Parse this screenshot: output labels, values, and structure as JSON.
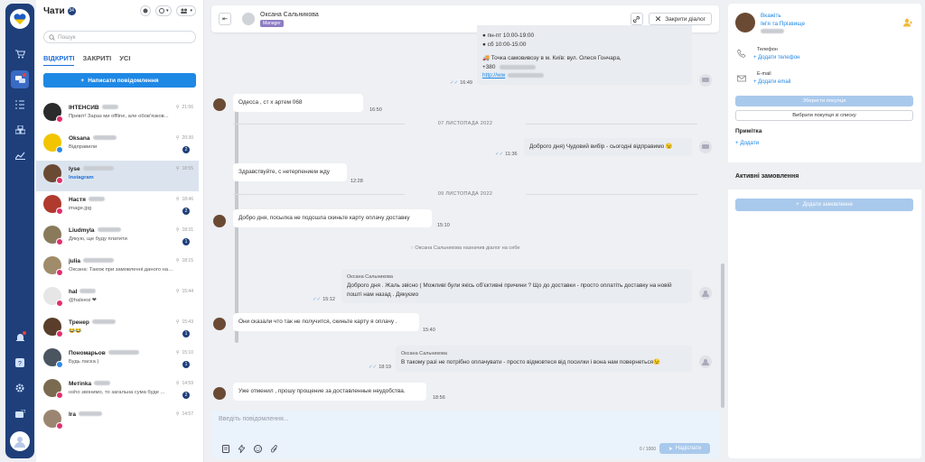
{
  "app": {
    "title": "Чати",
    "total_count": "34",
    "search_placeholder": "Пошук",
    "tabs": [
      "ВІДКРИТІ",
      "ЗАКРИТІ",
      "УСІ"
    ],
    "new_message_label": "Написати повідомлення"
  },
  "chat_list": [
    {
      "name": "ІНТЕНСИВ",
      "time": "21:56",
      "message": "Привіт! Зараз ми offline, але обов'язков...",
      "unread": "",
      "avatar_color": "#2b2b2b",
      "badge_color": "#e1306c",
      "selected": false
    },
    {
      "name": "Oksana",
      "time": "20:30",
      "message": "Відправили",
      "unread": "2",
      "avatar_color": "#f2c500",
      "badge_color": "#2f8ae6",
      "selected": false
    },
    {
      "name": "lyse",
      "time": "18:55",
      "message": "Instagram",
      "unread": "",
      "avatar_color": "#6b4a34",
      "badge_color": "#e1306c",
      "selected": true
    },
    {
      "name": "Настя",
      "time": "18:46",
      "message": "image.jpg",
      "unread": "2",
      "avatar_color": "#b03a2e",
      "badge_color": "#e1306c",
      "selected": false
    },
    {
      "name": "Liudmyla",
      "time": "18:31",
      "message": "Дякую, ще буду платити",
      "unread": "1",
      "avatar_color": "#8a7a5c",
      "badge_color": "#e1306c",
      "selected": false
    },
    {
      "name": "julia",
      "time": "18:15",
      "message": "Оксана: Також при замовленні даного наб...",
      "unread": "",
      "avatar_color": "#a08b6a",
      "badge_color": "#e1306c",
      "selected": false
    },
    {
      "name": "hal",
      "time": "15:44",
      "message": "@haleesi ❤",
      "unread": "",
      "avatar_color": "#e6e6e6",
      "badge_color": "#e1306c",
      "selected": false
    },
    {
      "name": "Тренер",
      "time": "15:43",
      "message": "😂😂",
      "unread": "1",
      "avatar_color": "#5a3e2b",
      "badge_color": "#e1306c",
      "selected": false
    },
    {
      "name": "Пономарьов",
      "time": "15:10",
      "message": "Будь ласка )",
      "unread": "1",
      "avatar_color": "#4a5560",
      "badge_color": "#2f8ae6",
      "selected": false
    },
    {
      "name": "Метіnka",
      "time": "14:59",
      "message": "нshо звонимо, то загальна сума буде ...",
      "unread": "2",
      "avatar_color": "#7a6a50",
      "badge_color": "#e1306c",
      "selected": false
    },
    {
      "name": "Ira",
      "time": "14:57",
      "message": "",
      "unread": "",
      "avatar_color": "#9a8670",
      "badge_color": "#e1306c",
      "selected": false
    }
  ],
  "chat_header": {
    "agent_name": "Оксана Сальникова",
    "agent_role": "Manager",
    "close_label": "Закрити діалог"
  },
  "messages": {
    "m0_lines": [
      "пн-пт 10:00-19:00",
      "сб 10:00-15:00",
      "",
      "🚚 Точка самовивозу в м. Київ: вул. Олеся Гончара,",
      "+380"
    ],
    "m0_link": "http://ww",
    "m0_time": "16:49",
    "m1_text": "Одесса , ст      х артем 068",
    "m1_time": "16:50",
    "sep1": "07 ЛИСТОПАДА 2022",
    "m2_text": "Доброго дня) Чудовий вибір - сьогодні відправимо 😉",
    "m2_time": "11:36",
    "m3_text": "Здравствуйте, с нетерпением жду",
    "m3_time": "12:28",
    "sep2": "09 ЛИСТОПАДА 2022",
    "m4_text": "Добро дня, посылка не подошла скиньте карту оплачу доставку",
    "m4_time": "15:10",
    "sys1": "Оксана Сальникова назначив діалог на себе",
    "m5_sender": "Оксана Сальникова",
    "m5_text": "Доброго дня . Жаль звісно ( Можливі були якісь об'єктивні причини ? Що до доставки - просто оплатіть доставку на новій пошті нам назад . Дякуємо",
    "m5_time": "15:12",
    "m6_text": "Они сказали что так не получится, скиньте карту я оплачу .",
    "m6_time": "15:40",
    "m7_sender": "Оксана Сальникова",
    "m7_text": "В такому разі не потрібно оплачувати - просто відмовтеся від посилки і вона нам повернеться😉",
    "m7_time": "18:19",
    "m8_text": "Уже отменил , прошу прощение за доставленные неудобства.",
    "m8_time": "18:56"
  },
  "composer": {
    "placeholder": "Введіть повідомлення...",
    "counter": "0 / 1000",
    "send_label": "Надіслати"
  },
  "sidebar": {
    "name_link_1": "Вкажіть",
    "name_link_2": "Ім'я та Прізвище",
    "phone_label": "Телефон",
    "phone_add": "Додати телефон",
    "email_label": "E-mail",
    "email_add": "Додати email",
    "save_customer": "Зберегти покупця",
    "pick_customer": "Вибрати покупця зі списку",
    "note_title": "Примітка",
    "note_add": "Додати",
    "orders_title": "Активні замовлення",
    "add_order": "Додати замовлення"
  },
  "colors": {
    "rail": "#1e3f7a",
    "accent": "#1e88e5",
    "instagram": "#e1306c"
  }
}
